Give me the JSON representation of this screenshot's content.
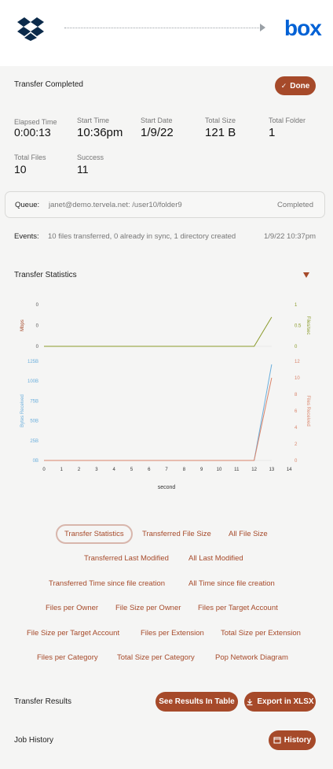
{
  "header": {
    "source_icon": "dropbox-icon",
    "destination_logo": "box"
  },
  "status": {
    "title": "Transfer Completed",
    "done_label": "Done"
  },
  "stats": [
    {
      "label": "Elapsed Time",
      "value": "0:00:13"
    },
    {
      "label": "Start Time",
      "value": "10:36pm"
    },
    {
      "label": "Start Date",
      "value": "1/9/22"
    },
    {
      "label": "Total Size",
      "value": "121 B"
    },
    {
      "label": "Total Folder",
      "value": "1"
    },
    {
      "label": "Total Files",
      "value": "10"
    },
    {
      "label": "Success",
      "value": "11"
    }
  ],
  "queue": {
    "label": "Queue:",
    "path": "janet@demo.tervela.net: /user10/folder9",
    "status": "Completed"
  },
  "events": {
    "label": "Events:",
    "text": "10 files transferred, 0 already in sync, 1 directory created",
    "time": "1/9/22 10:37pm"
  },
  "transfer_statistics": {
    "title": "Transfer Statistics",
    "filter_icon": "filter-icon"
  },
  "chart_data": [
    {
      "type": "line",
      "x": [
        0,
        1,
        2,
        3,
        4,
        5,
        6,
        7,
        8,
        9,
        10,
        11,
        12,
        13
      ],
      "x_ticks": [
        "0",
        "1",
        "2",
        "3",
        "4",
        "5",
        "6",
        "7",
        "8",
        "9",
        "10",
        "11",
        "12",
        "13",
        "14"
      ],
      "xlabel": "second",
      "left_axis": {
        "label": "Mbps",
        "ticks": [
          "0",
          "0",
          "0"
        ]
      },
      "right_axis": {
        "label": "Files/sec",
        "ticks": [
          "0",
          "0.5",
          "1"
        ],
        "range": [
          0,
          1
        ]
      },
      "series": [
        {
          "color": "#8a9a2a",
          "values": [
            0,
            0,
            0,
            0,
            0,
            0,
            0,
            0,
            0,
            0,
            0,
            0,
            0,
            0.7
          ]
        }
      ]
    },
    {
      "type": "line",
      "x": [
        0,
        1,
        2,
        3,
        4,
        5,
        6,
        7,
        8,
        9,
        10,
        11,
        12,
        13
      ],
      "xlabel": "second",
      "left_axis": {
        "label": "Bytes Received",
        "ticks": [
          "0B",
          "25B",
          "50B",
          "75B",
          "100B",
          "125B"
        ],
        "range": [
          0,
          125
        ]
      },
      "right_axis": {
        "label": "Files Received",
        "ticks": [
          "0",
          "2",
          "4",
          "6",
          "8",
          "10",
          "12"
        ],
        "range": [
          0,
          12
        ]
      },
      "series": [
        {
          "color": "#6aaedc",
          "axis": "left",
          "values": [
            0,
            0,
            0,
            0,
            0,
            0,
            0,
            0,
            0,
            0,
            0,
            0,
            0,
            121
          ]
        },
        {
          "color": "#d9846a",
          "axis": "right",
          "values": [
            0,
            0,
            0,
            0,
            0,
            0,
            0,
            0,
            0,
            0,
            0,
            0,
            0,
            10
          ]
        }
      ]
    }
  ],
  "report_tags": [
    "Transfer Statistics",
    "Transferred File Size",
    "All File Size",
    "Transferred Last Modified",
    "All Last Modified",
    "Transferred Time since file creation",
    "All Time since file creation",
    "Files per Owner",
    "File Size per Owner",
    "Files per Target Account",
    "File Size per Target Account",
    "Files per Extension",
    "Total Size per Extension",
    "Files per Category",
    "Total Size per Category",
    "Pop Network Diagram"
  ],
  "transfer_results": {
    "title": "Transfer Results",
    "see_results_label": "See Results In Table",
    "export_label": "Export in XLSX",
    "export_icon": "download-icon"
  },
  "job_history": {
    "title": "Job History",
    "history_label": "History",
    "history_icon": "history-icon"
  }
}
